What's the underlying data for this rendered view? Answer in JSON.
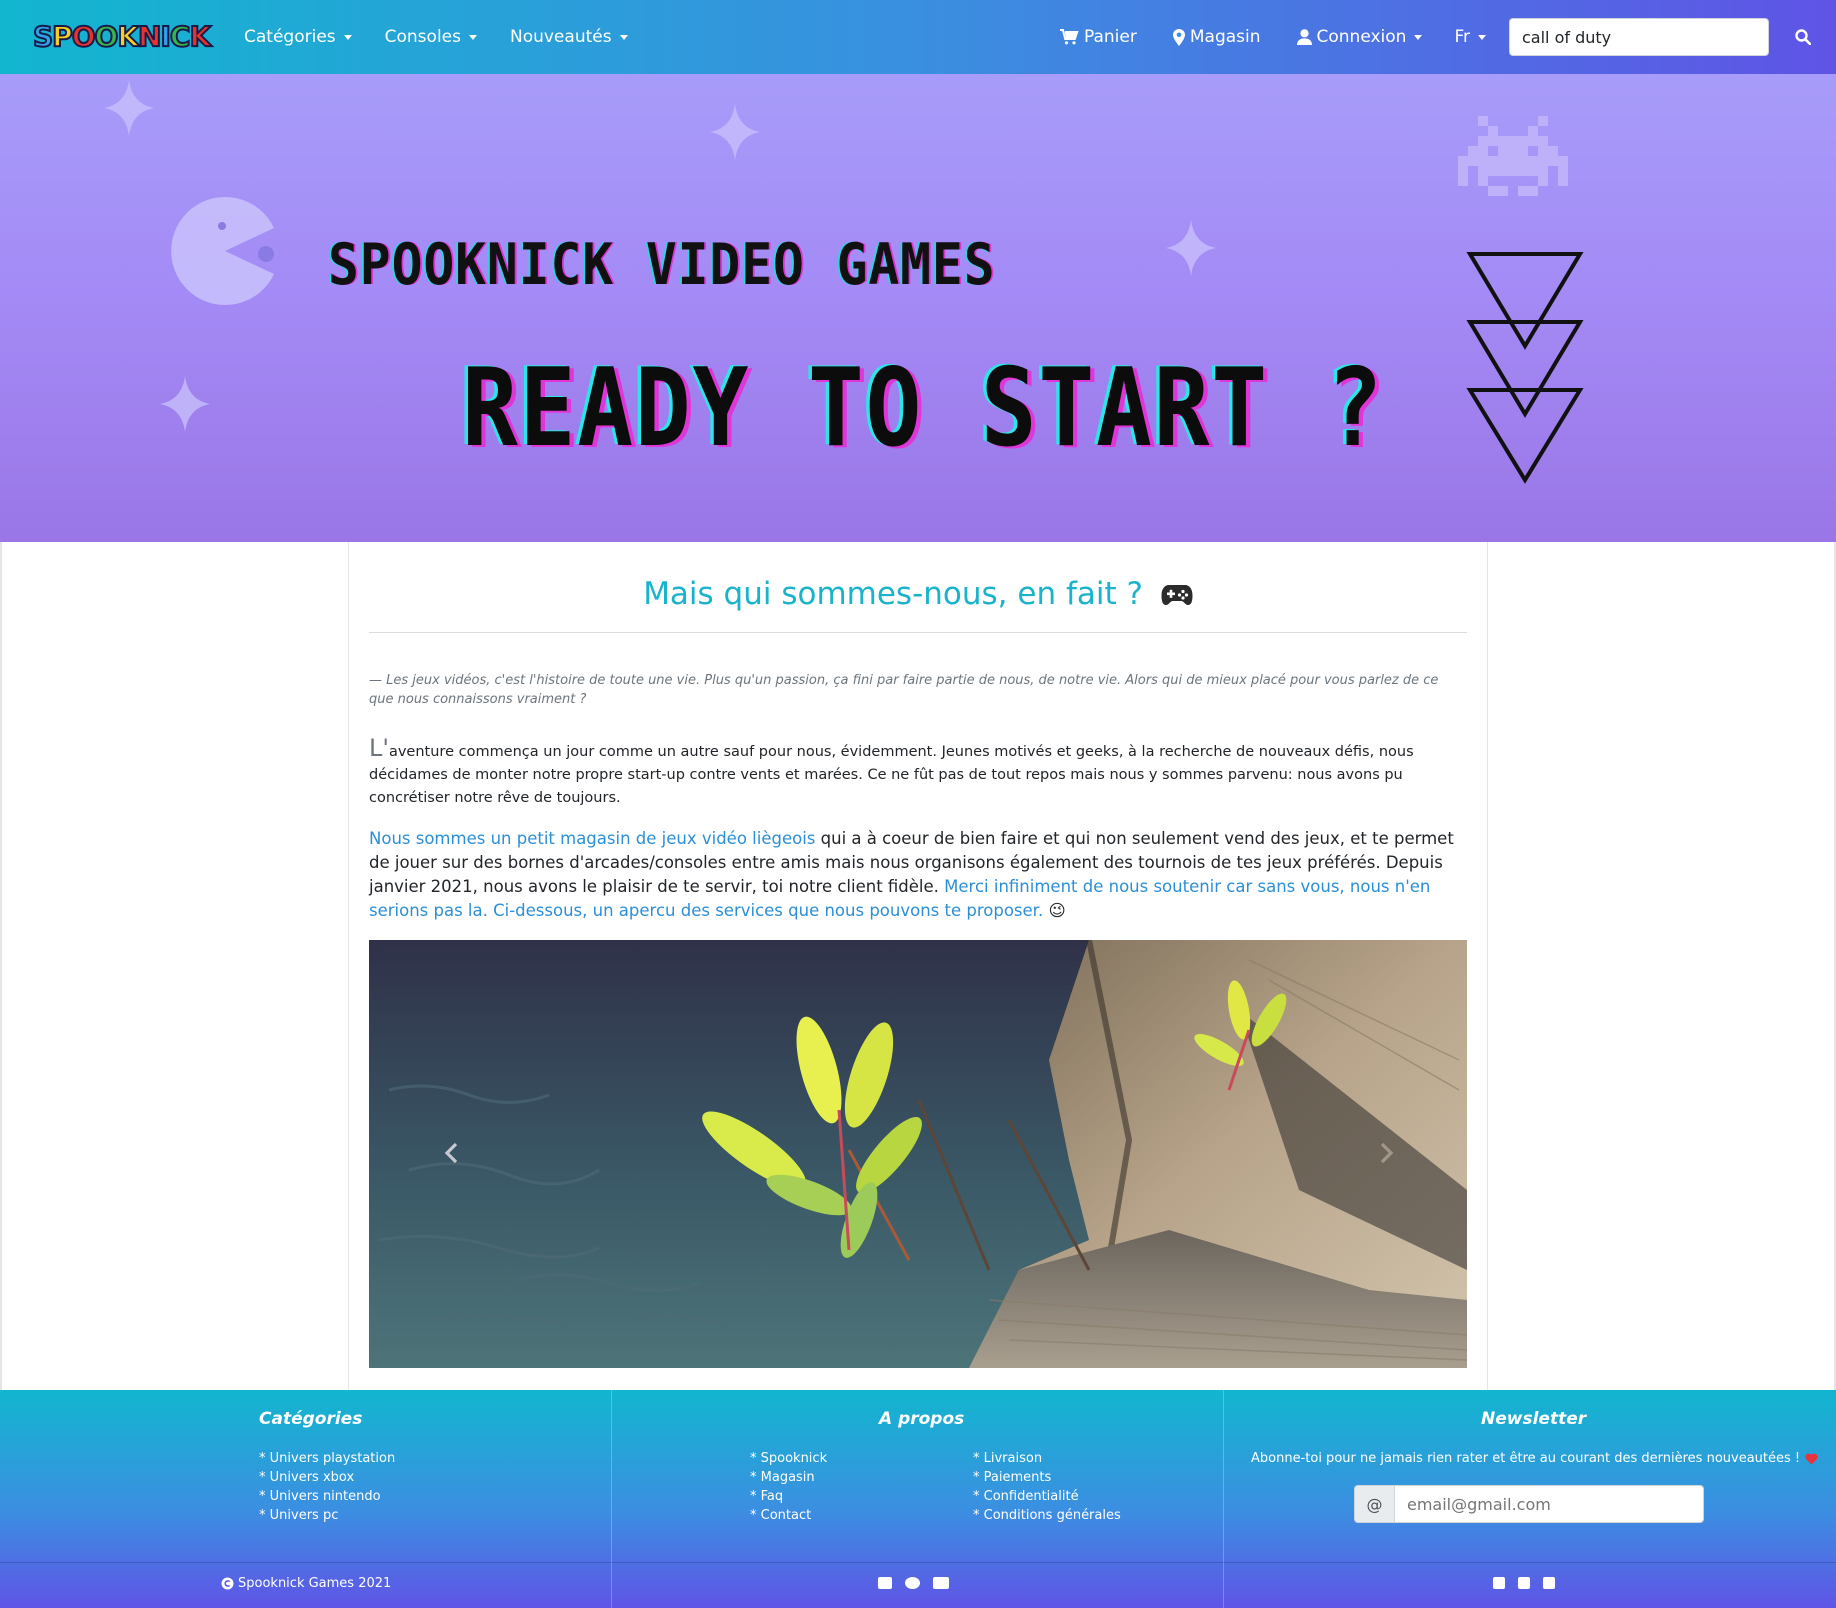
{
  "brand": {
    "logo_text": "SPOOKNICK",
    "logo_letters": [
      "S",
      "P",
      "O",
      "O",
      "K",
      "N",
      "I",
      "C",
      "K"
    ],
    "logo_colors": [
      "#2fa1e6",
      "#f5d022",
      "#e8332a",
      "#38b549",
      "#f5d022",
      "#e8332a",
      "#2fa1e6",
      "#38b549",
      "#e8332a"
    ]
  },
  "nav": {
    "left": [
      {
        "label": "Catégories"
      },
      {
        "label": "Consoles"
      },
      {
        "label": "Nouveautés"
      }
    ],
    "right": [
      {
        "label": "Panier",
        "icon": "cart-icon"
      },
      {
        "label": "Magasin",
        "icon": "map-marker-icon"
      },
      {
        "label": "Connexion",
        "icon": "user-icon"
      },
      {
        "label": "Fr"
      }
    ],
    "search_value": "call of duty"
  },
  "hero": {
    "title": "SPOOKNICK VIDEO GAMES",
    "subtitle": "READY TO START ?"
  },
  "main": {
    "heading": "Mais qui sommes-nous, en fait ?",
    "quote": "— Les jeux vidéos, c'est l'histoire de toute une vie. Plus qu'un passion, ça fini par faire partie de nous, de notre vie. Alors qui de mieux placé pour vous parlez de ce que nous connaissons vraiment ?",
    "para1_dropcap": "L'",
    "para1": "aventure commença un jour comme un autre sauf pour nous, évidemment. Jeunes motivés et geeks, à la recherche de nouveaux défis, nous décidames de monter notre propre start-up contre vents et marées. Ce ne fût pas de tout repos mais nous y sommes parvenu: nous avons pu concrétiser notre rêve de toujours.",
    "para2_link1": "Nous sommes un petit magasin de jeux vidéo liègeois",
    "para2_text": " qui a à coeur de bien faire et qui non seulement vend des jeux, et te permet de jouer sur des bornes d'arcades/consoles entre amis mais nous organisons également des tournois de tes jeux préférés. Depuis janvier 2021, nous avons le plaisir de te servir, toi notre client fidèle. ",
    "para2_link2": "Merci infiniment de nous soutenir car sans vous, nous n'en serions pas la. Ci-dessous, un apercu des services que nous pouvons te proposer.",
    "wink": "😉"
  },
  "footer": {
    "categories": {
      "heading": "Catégories",
      "items": [
        "* Univers playstation",
        "* Univers xbox",
        "* Univers nintendo",
        "* Univers pc"
      ]
    },
    "about": {
      "heading": "A propos",
      "col1": [
        "* Spooknick",
        "* Magasin",
        "* Faq",
        "* Contact"
      ],
      "col2": [
        "* Livraison",
        "* Paiements",
        "* Confidentialité",
        "* Conditions générales"
      ]
    },
    "newsletter": {
      "heading": "Newsletter",
      "text": "Abonne-toi pour ne jamais rien rater et être au courant des dernières nouveautées !",
      "prefix": "@",
      "placeholder": "email@gmail.com"
    },
    "copyright": "Spooknick Games 2021",
    "payment_icons": [
      "visa-icon",
      "mastercard-icon",
      "credit-card-icon"
    ],
    "social_icons": [
      "twitter-icon",
      "facebook-icon",
      "instagram-icon"
    ]
  },
  "colors": {
    "accent_teal": "#19b3cc",
    "link_blue": "#2c8fd6",
    "gradient_start": "#12b6cf",
    "gradient_end": "#5f54e6",
    "hero_purple": "#a48bf6"
  }
}
